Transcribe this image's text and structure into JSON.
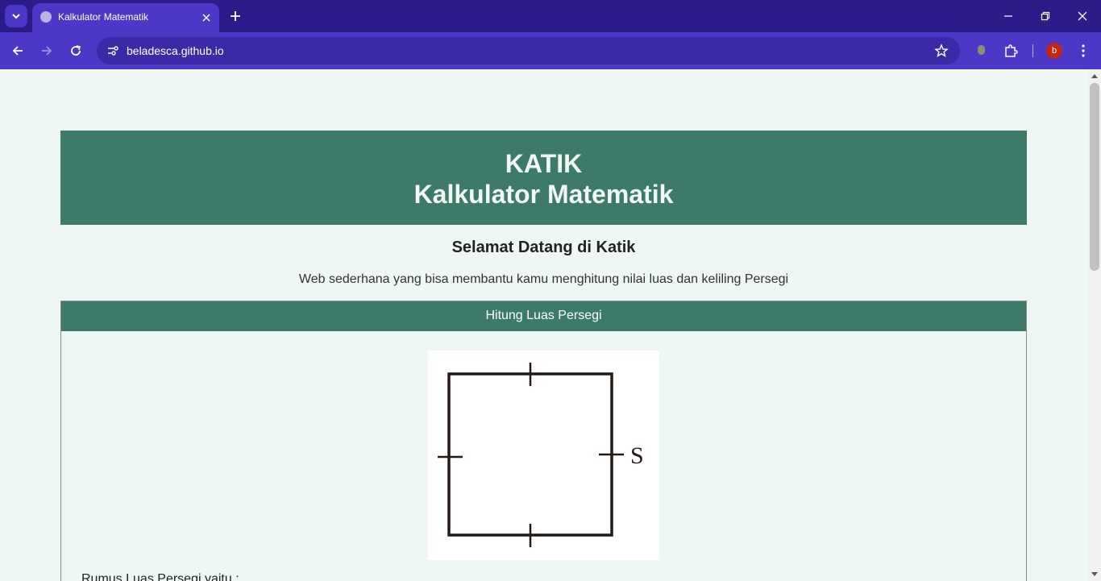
{
  "browser": {
    "tab": {
      "title": "Kalkulator Matematik"
    },
    "url": "beladesca.github.io",
    "profile_initial": "b"
  },
  "page": {
    "header": {
      "line1": "KATIK",
      "line2": "Kalkulator Matematik"
    },
    "welcome": "Selamat Datang di Katik",
    "description": "Web sederhana yang bisa membantu kamu menghitung nilai luas dan keliling Persegi",
    "card": {
      "title": "Hitung Luas Persegi",
      "figure_label": "S",
      "formula_intro": "Rumus Luas Persegi yaitu :"
    }
  },
  "colors": {
    "chrome_dark": "#2c1c8a",
    "chrome_light": "#4b38c6",
    "banner": "#3d7a69",
    "page_bg": "#eef7f4"
  }
}
